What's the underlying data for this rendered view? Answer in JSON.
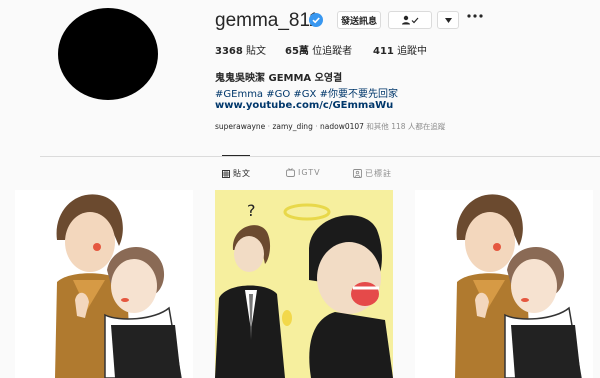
{
  "profile": {
    "username": "gemma_811",
    "full_name": "鬼鬼吳映潔 GEMMA 오영결",
    "hashtags": "#GEmma #GO #GX #你要不要先回家",
    "link": "www.youtube.com/c/GEmmaWu",
    "message_button": "發送訊息"
  },
  "stats": {
    "posts_count": "3368",
    "posts_label": "貼文",
    "followers_count": "65萬",
    "followers_label": "位追蹤者",
    "following_count": "411",
    "following_label": "追蹤中"
  },
  "followed_by": {
    "users": [
      "superawayne",
      "zamy_ding",
      "nadow0107"
    ],
    "suffix": "和其他 118 人都在追蹤"
  },
  "tabs": [
    {
      "label": "貼文",
      "icon": "grid-icon"
    },
    {
      "label": "IGTV",
      "icon": "igtv-icon"
    },
    {
      "label": "已標註",
      "icon": "tagged-icon"
    }
  ],
  "colors": {
    "link": "#00376b",
    "verified": "#3897f0",
    "muted": "#8e8e8e"
  }
}
